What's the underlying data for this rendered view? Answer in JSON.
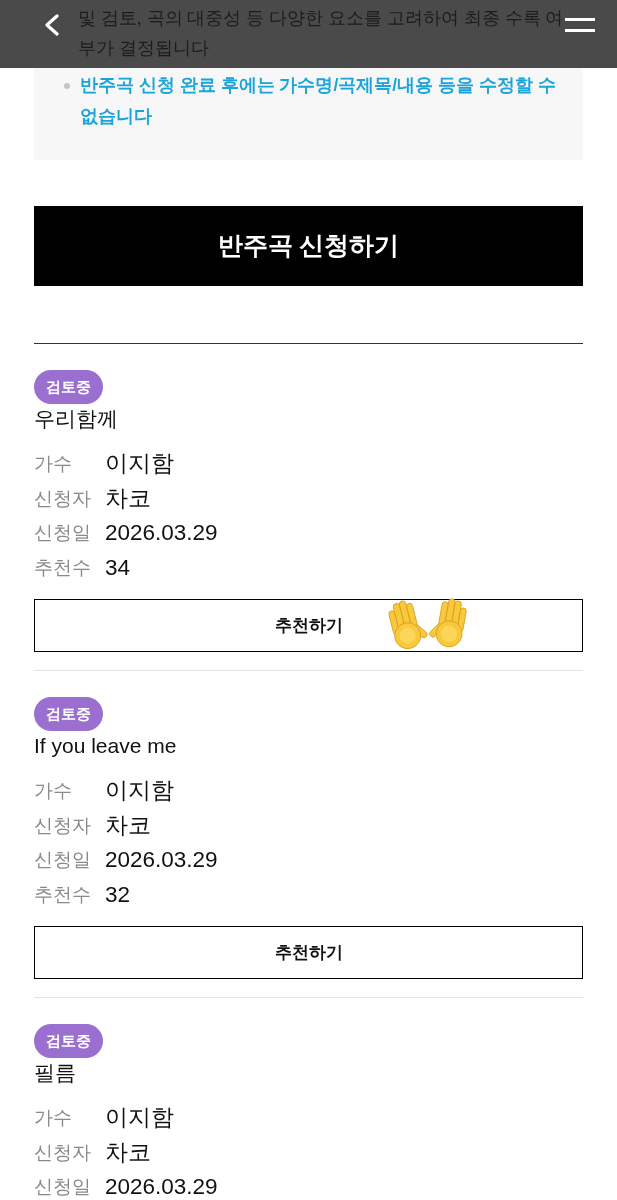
{
  "notice": {
    "items": [
      {
        "kind": "covered",
        "text": "및 검토, 곡의 대중성 등 다양한 요소를 고려하여 최종 수록 여부가 결정됩니다",
        "highlight": false
      },
      {
        "kind": "bulleted",
        "text": "반주곡 신청 완료 후에는 가수명/곡제목/내용 등을 수정할 수 없습니다",
        "highlight": true
      }
    ]
  },
  "apply_button": {
    "label": "반주곡 신청하기"
  },
  "requests": [
    {
      "status": "검토중",
      "title": "우리함께",
      "fields": [
        {
          "label": "가수",
          "value": "이지함"
        },
        {
          "label": "신청자",
          "value": "차코"
        },
        {
          "label": "신청일",
          "value": "2026.03.29"
        },
        {
          "label": "추천수",
          "value": "34"
        }
      ],
      "button": "추천하기"
    },
    {
      "status": "검토중",
      "title": "If you leave me",
      "fields": [
        {
          "label": "가수",
          "value": "이지함"
        },
        {
          "label": "신청자",
          "value": "차코"
        },
        {
          "label": "신청일",
          "value": "2026.03.29"
        },
        {
          "label": "추천수",
          "value": "32"
        }
      ],
      "button": "추천하기"
    },
    {
      "status": "검토중",
      "title": "필름",
      "fields": [
        {
          "label": "가수",
          "value": "이지함"
        },
        {
          "label": "신청자",
          "value": "차코"
        },
        {
          "label": "신청일",
          "value": "2026.03.29"
        }
      ]
    }
  ]
}
